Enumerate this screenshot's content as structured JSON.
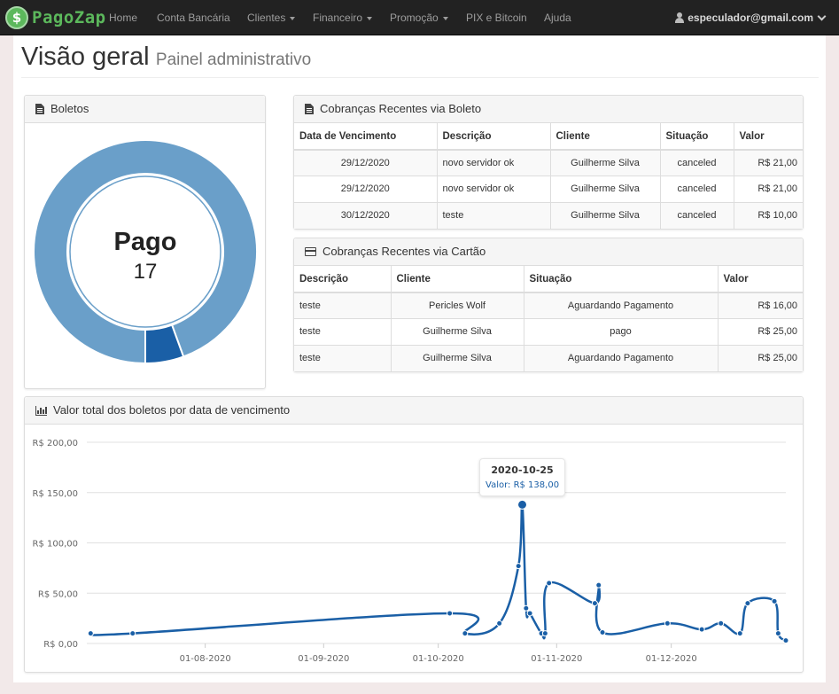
{
  "navbar": {
    "brand": "PagoZap",
    "brand_symbol": "$",
    "items": [
      {
        "label": "Home",
        "dropdown": false
      },
      {
        "label": "Conta Bancária",
        "dropdown": false
      },
      {
        "label": "Clientes",
        "dropdown": true
      },
      {
        "label": "Financeiro",
        "dropdown": true
      },
      {
        "label": "Promoção",
        "dropdown": true
      },
      {
        "label": "PIX e Bitcoin",
        "dropdown": false
      },
      {
        "label": "Ajuda",
        "dropdown": false
      }
    ],
    "user": "especulador@gmail.com"
  },
  "header": {
    "title": "Visão geral",
    "subtitle": "Painel administrativo"
  },
  "boletos_panel": {
    "title": "Boletos",
    "center_label": "Pago",
    "center_value": "17",
    "donut": [
      {
        "status": "Pago",
        "value": 17,
        "color": "#6a9fc9"
      },
      {
        "status": "other",
        "value": 1,
        "color": "#1a5fa6"
      }
    ]
  },
  "boleto_table": {
    "title": "Cobranças Recentes via Boleto",
    "columns": [
      "Data de Vencimento",
      "Descrição",
      "Cliente",
      "Situação",
      "Valor"
    ],
    "rows": [
      [
        "29/12/2020",
        "novo servidor ok",
        "Guilherme Silva",
        "canceled",
        "R$ 21,00"
      ],
      [
        "29/12/2020",
        "novo servidor ok",
        "Guilherme Silva",
        "canceled",
        "R$ 21,00"
      ],
      [
        "30/12/2020",
        "teste",
        "Guilherme Silva",
        "canceled",
        "R$ 10,00"
      ]
    ]
  },
  "card_table": {
    "title": "Cobranças Recentes via Cartão",
    "columns": [
      "Descrição",
      "Cliente",
      "Situação",
      "Valor"
    ],
    "rows": [
      [
        "teste",
        "Pericles Wolf",
        "Aguardando Pagamento",
        "R$ 16,00"
      ],
      [
        "teste",
        "Guilherme Silva",
        "pago",
        "R$ 25,00"
      ],
      [
        "teste",
        "Guilherme Silva",
        "Aguardando Pagamento",
        "R$ 25,00"
      ]
    ]
  },
  "chart_panel": {
    "title": "Valor total dos boletos por data de vencimento"
  },
  "chart_data": {
    "type": "line",
    "title": "Valor total dos boletos por data de vencimento",
    "xlabel": "",
    "ylabel": "",
    "ylim": [
      0,
      200
    ],
    "y_ticks": [
      "R$ 0,00",
      "R$ 50,00",
      "R$ 100,00",
      "R$ 150,00",
      "R$ 200,00"
    ],
    "y_tick_values": [
      0,
      50,
      100,
      150,
      200
    ],
    "x_ticks": [
      "01-08-2020",
      "01-09-2020",
      "01-10-2020",
      "01-11-2020",
      "01-12-2020"
    ],
    "x_tick_dates": [
      "2020-08-01",
      "2020-09-01",
      "2020-10-01",
      "2020-11-01",
      "2020-12-01"
    ],
    "xlim": [
      "2020-07-01",
      "2020-12-31"
    ],
    "color": "#1a5fa6",
    "series": [
      {
        "points": [
          [
            "2020-07-02",
            10
          ],
          [
            "2020-07-13",
            10
          ],
          [
            "2020-10-04",
            30
          ],
          [
            "2020-10-08",
            10
          ],
          [
            "2020-10-17",
            20
          ],
          [
            "2020-10-22",
            77
          ],
          [
            "2020-10-23",
            138
          ],
          [
            "2020-10-24",
            35
          ],
          [
            "2020-10-25",
            30
          ],
          [
            "2020-10-28",
            10
          ],
          [
            "2020-10-29",
            10
          ],
          [
            "2020-10-30",
            60
          ],
          [
            "2020-11-11",
            40
          ],
          [
            "2020-11-12",
            58
          ],
          [
            "2020-11-13",
            11
          ],
          [
            "2020-11-30",
            20
          ],
          [
            "2020-12-09",
            14
          ],
          [
            "2020-12-14",
            20
          ],
          [
            "2020-12-19",
            10
          ],
          [
            "2020-12-21",
            40
          ],
          [
            "2020-12-28",
            42
          ],
          [
            "2020-12-29",
            10
          ],
          [
            "2020-12-31",
            3
          ]
        ]
      }
    ],
    "tooltip": {
      "title": "2020-10-25",
      "label": "Valor: R$ 138,00"
    }
  }
}
